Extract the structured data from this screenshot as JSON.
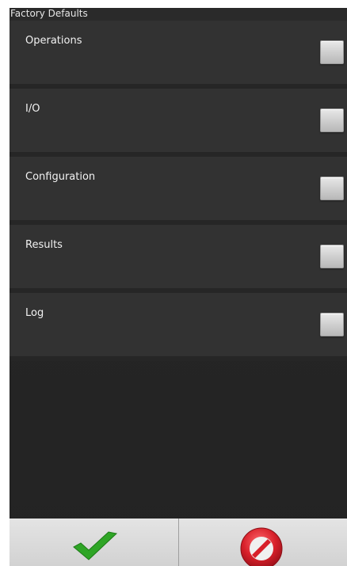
{
  "dialog": {
    "title": "Factory Defaults"
  },
  "options": [
    {
      "label": "Operations",
      "checked": false
    },
    {
      "label": "I/O",
      "checked": false
    },
    {
      "label": "Configuration",
      "checked": false
    },
    {
      "label": "Results",
      "checked": false
    },
    {
      "label": "Log",
      "checked": false
    }
  ],
  "footer": {
    "confirm_icon": "checkmark-icon",
    "cancel_icon": "cancel-icon",
    "confirm_color": "#2fa526",
    "cancel_color": "#d8202a"
  }
}
